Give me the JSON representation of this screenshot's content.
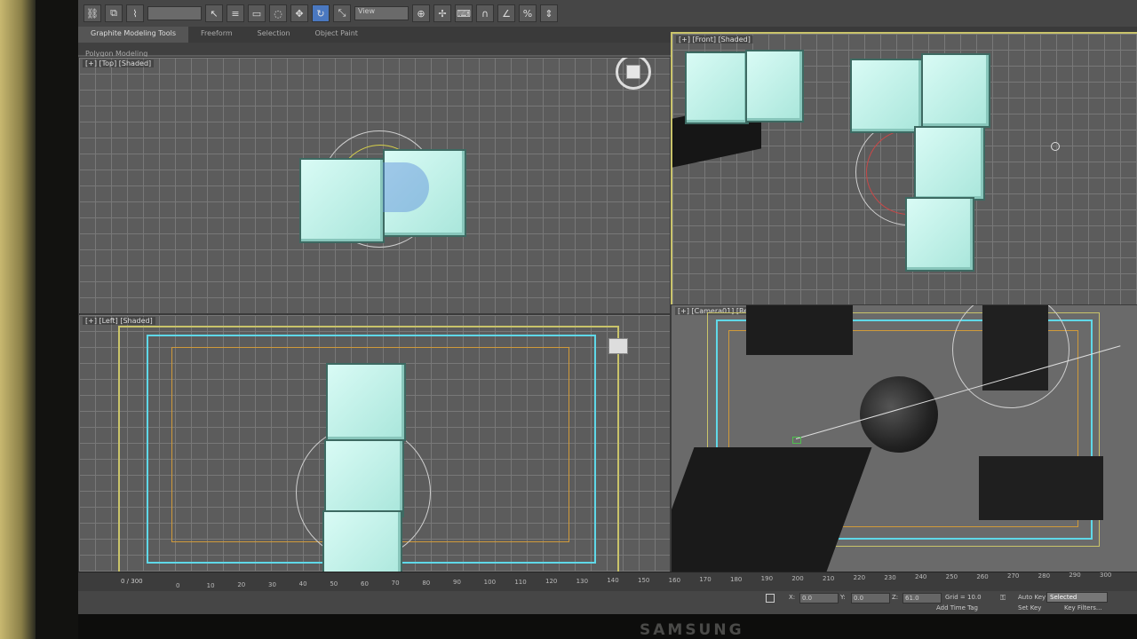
{
  "toolbar": {
    "selection_filter": "",
    "reference_coord": "View"
  },
  "ribbon": {
    "tabs": [
      "Graphite Modeling Tools",
      "Freeform",
      "Selection",
      "Object Paint"
    ],
    "subpanel_label": "Polygon Modeling"
  },
  "viewports": {
    "top": "[+] [Top] [Shaded]",
    "front": "[+] [Front] [Shaded]",
    "left": "[+] [Left] [Shaded]",
    "camera": "[+] [Camera01] [Realistic]"
  },
  "timeline": {
    "frame_counter": "0 / 300",
    "ticks": [
      "0",
      "10",
      "20",
      "30",
      "40",
      "50",
      "60",
      "70",
      "80",
      "90",
      "100",
      "110",
      "120",
      "130",
      "140",
      "150",
      "160",
      "170",
      "180",
      "190",
      "200",
      "210",
      "220",
      "230",
      "240",
      "250",
      "260",
      "270",
      "280",
      "290",
      "300"
    ]
  },
  "status": {
    "x_label": "X:",
    "x_value": "0.0",
    "y_label": "Y:",
    "y_value": "0.0",
    "z_label": "Z:",
    "z_value": "61.0",
    "grid": "Grid = 10.0",
    "add_time_tag": "Add Time Tag",
    "auto_key": "Auto Key",
    "set_key": "Set Key",
    "selected": "Selected",
    "key_filters": "Key Filters..."
  },
  "monitor": {
    "brand": "SAMSUNG"
  },
  "colors": {
    "active_viewport_border": "#c9c36a",
    "box_face": "#cdf5ee",
    "grid_line": "#787878"
  }
}
